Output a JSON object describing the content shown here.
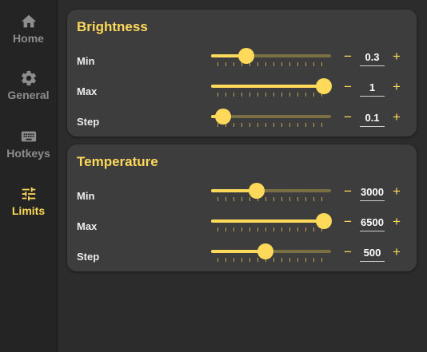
{
  "sidebar": {
    "items": [
      {
        "label": "Home",
        "icon": "home-icon"
      },
      {
        "label": "General",
        "icon": "gear-icon"
      },
      {
        "label": "Hotkeys",
        "icon": "keyboard-icon"
      },
      {
        "label": "Limits",
        "icon": "sliders-icon",
        "active": true
      }
    ]
  },
  "colors": {
    "accent": "#ffd95a",
    "card": "#3d3d3d",
    "background": "#2c2c2c",
    "sidebar": "#242424"
  },
  "brightness": {
    "title": "Brightness",
    "rows": [
      {
        "label": "Min",
        "value": "0.3",
        "slider_fraction": 0.29
      },
      {
        "label": "Max",
        "value": "1",
        "slider_fraction": 0.94
      },
      {
        "label": "Step",
        "value": "0.1",
        "slider_fraction": 0.1
      }
    ]
  },
  "temperature": {
    "title": "Temperature",
    "rows": [
      {
        "label": "Min",
        "value": "3000",
        "slider_fraction": 0.38
      },
      {
        "label": "Max",
        "value": "6500",
        "slider_fraction": 0.94
      },
      {
        "label": "Step",
        "value": "500",
        "slider_fraction": 0.45
      }
    ]
  },
  "stepper": {
    "minus": "−",
    "plus": "+"
  }
}
